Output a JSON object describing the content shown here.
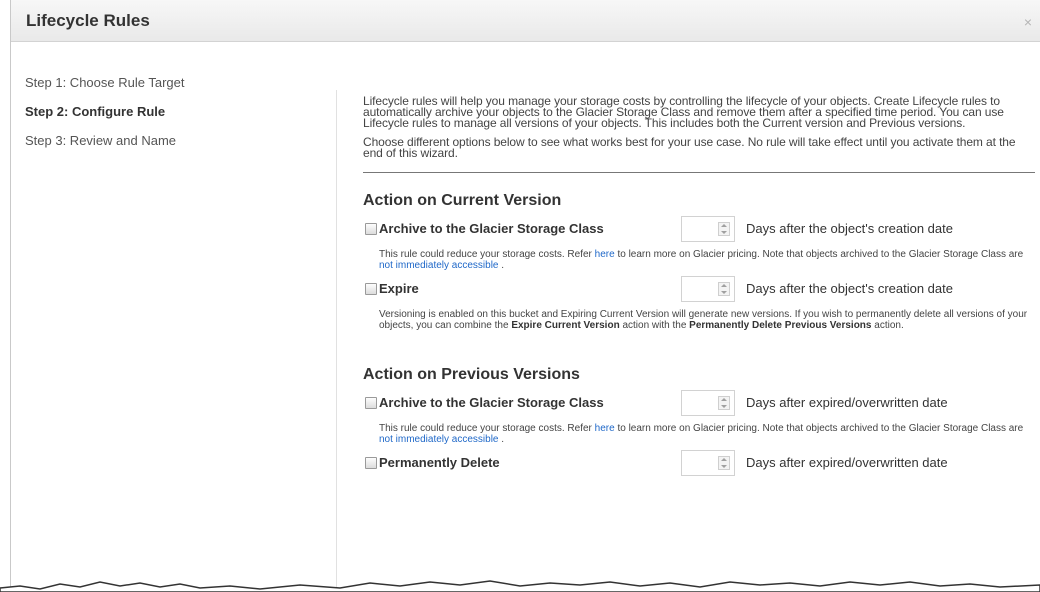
{
  "dialog": {
    "title": "Lifecycle Rules",
    "close": "×"
  },
  "steps": [
    {
      "label": "Step 1: Choose Rule Target"
    },
    {
      "label": "Step 2: Configure Rule"
    },
    {
      "label": "Step 3: Review and Name"
    }
  ],
  "intro": {
    "paragraph1": "Lifecycle rules will help you manage your storage costs by controlling the lifecycle of your objects. Create Lifecycle rules to automatically archive your objects to the Glacier Storage Class and remove them after a specified time period. You can use Lifecycle rules to manage all versions of your objects. This includes both the Current version and Previous versions.",
    "paragraph2": "Choose different options below to see what works best for your use case. No rule will take effect until you activate them at the end of this wizard."
  },
  "current": {
    "title": "Action on Current Version",
    "archive": {
      "label": "Archive to the Glacier Storage Class",
      "days_value": "",
      "days_label": "Days after the object's creation date",
      "note_a": "This rule could reduce your storage costs. Refer ",
      "note_link1": "here",
      "note_b": " to learn more on Glacier pricing. Note that objects archived to the Glacier Storage Class are ",
      "note_link2": "not immediately accessible",
      "note_c": " ."
    },
    "expire": {
      "label": "Expire",
      "days_value": "",
      "days_label": "Days after the object's creation date",
      "note_a": "Versioning is enabled on this bucket and Expiring Current Version will generate new versions. If you wish to permanently delete all versions of your objects, you can combine the ",
      "note_b1": "Expire Current Version",
      "note_b": " action with the ",
      "note_b2": "Permanently Delete Previous Versions",
      "note_c": " action."
    }
  },
  "previous": {
    "title": "Action on Previous Versions",
    "archive": {
      "label": "Archive to the Glacier Storage Class",
      "days_value": "",
      "days_label": "Days after expired/overwritten date",
      "note_a": "This rule could reduce your storage costs. Refer ",
      "note_link1": "here",
      "note_b": " to learn more on Glacier pricing. Note that objects archived to the Glacier Storage Class are ",
      "note_link2": "not immediately accessible",
      "note_c": " ."
    },
    "delete": {
      "label": "Permanently Delete",
      "days_value": "",
      "days_label": "Days after expired/overwritten date"
    }
  },
  "colors": {
    "link": "#1f68c8",
    "header_bg": "#eeeeee"
  }
}
